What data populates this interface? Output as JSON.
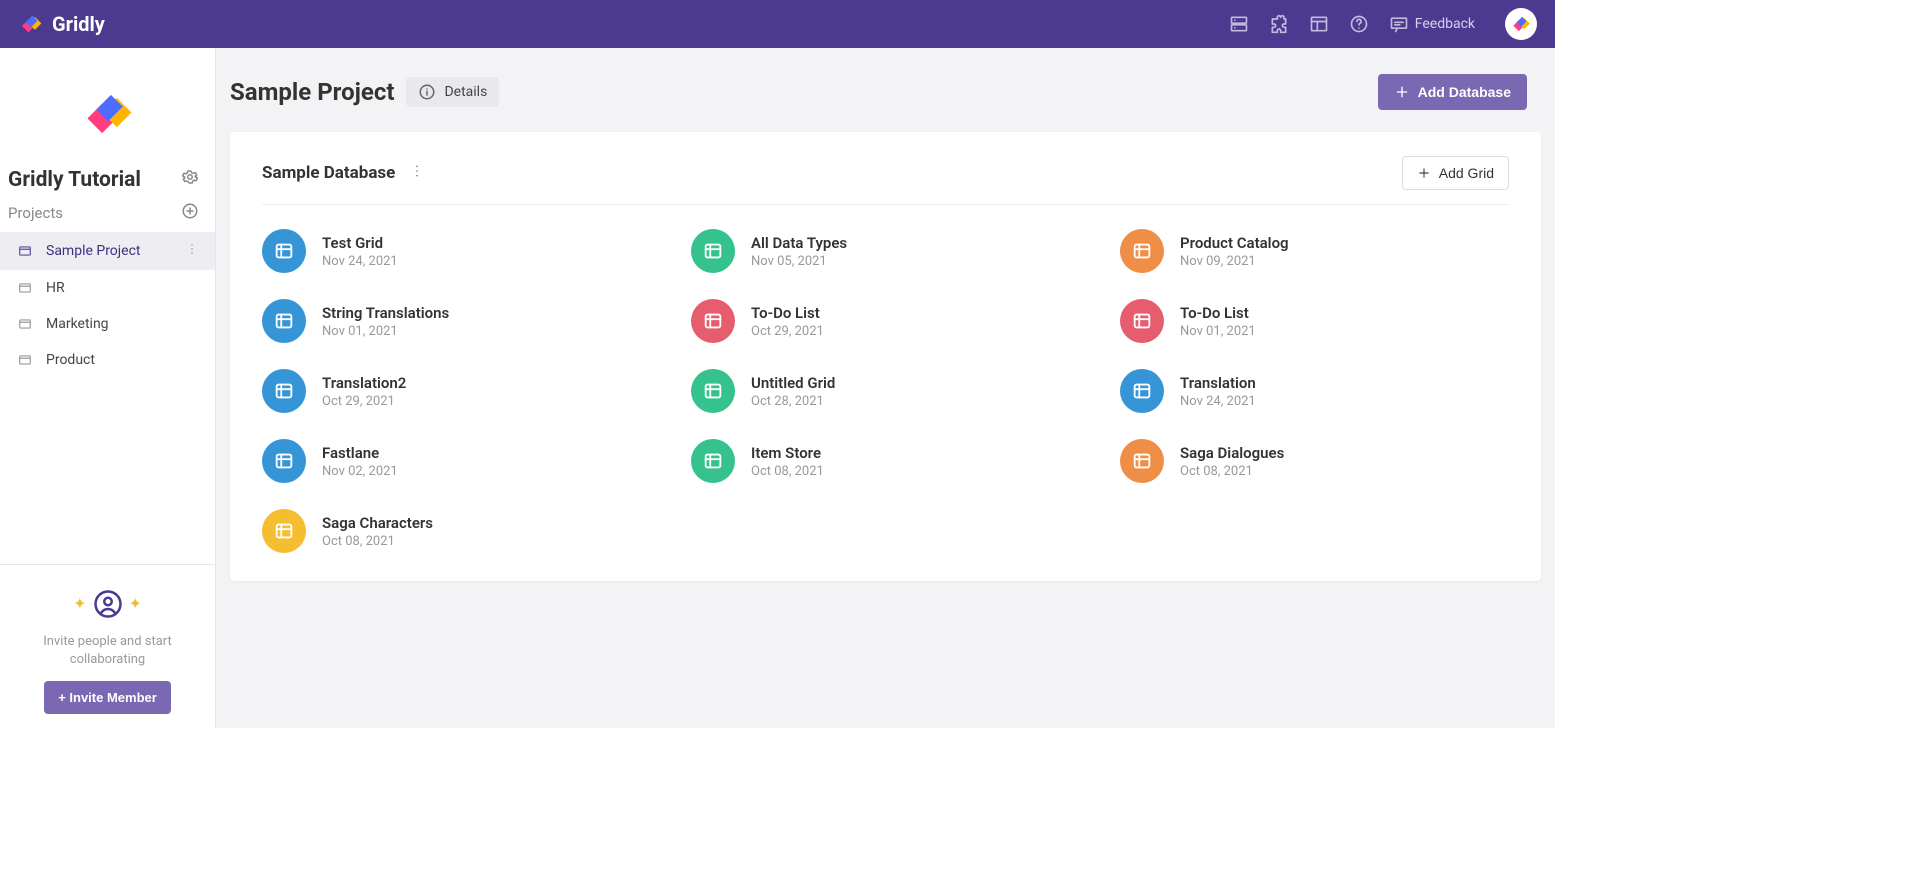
{
  "brand": {
    "name": "Gridly"
  },
  "topbar": {
    "feedback_label": "Feedback"
  },
  "workspace": {
    "name": "Gridly Tutorial",
    "section_label": "Projects"
  },
  "projects": [
    {
      "name": "Sample Project",
      "active": true
    },
    {
      "name": "HR",
      "active": false
    },
    {
      "name": "Marketing",
      "active": false
    },
    {
      "name": "Product",
      "active": false
    }
  ],
  "invite": {
    "text": "Invite people and start collaborating",
    "button": "+ Invite Member"
  },
  "main": {
    "project_title": "Sample Project",
    "details_label": "Details",
    "add_database_label": "Add Database"
  },
  "database": {
    "name": "Sample Database",
    "add_grid_label": "Add Grid"
  },
  "grid_colors": {
    "blue": "#3595d6",
    "teal": "#35c28d",
    "orange": "#ef8e46",
    "pink": "#e65d6d",
    "yellow": "#f5bd30"
  },
  "grids": [
    {
      "name": "Test Grid",
      "date": "Nov 24, 2021",
      "color": "blue"
    },
    {
      "name": "All Data Types",
      "date": "Nov 05, 2021",
      "color": "teal"
    },
    {
      "name": "Product Catalog",
      "date": "Nov 09, 2021",
      "color": "orange"
    },
    {
      "name": "String Translations",
      "date": "Nov 01, 2021",
      "color": "blue"
    },
    {
      "name": "To-Do List",
      "date": "Oct 29, 2021",
      "color": "pink"
    },
    {
      "name": "To-Do List",
      "date": "Nov 01, 2021",
      "color": "pink"
    },
    {
      "name": "Translation2",
      "date": "Oct 29, 2021",
      "color": "blue"
    },
    {
      "name": "Untitled Grid",
      "date": "Oct 28, 2021",
      "color": "teal"
    },
    {
      "name": "Translation",
      "date": "Nov 24, 2021",
      "color": "blue"
    },
    {
      "name": "Fastlane",
      "date": "Nov 02, 2021",
      "color": "blue"
    },
    {
      "name": "Item Store",
      "date": "Oct 08, 2021",
      "color": "teal"
    },
    {
      "name": "Saga Dialogues",
      "date": "Oct 08, 2021",
      "color": "orange"
    },
    {
      "name": "Saga Characters",
      "date": "Oct 08, 2021",
      "color": "yellow"
    }
  ]
}
